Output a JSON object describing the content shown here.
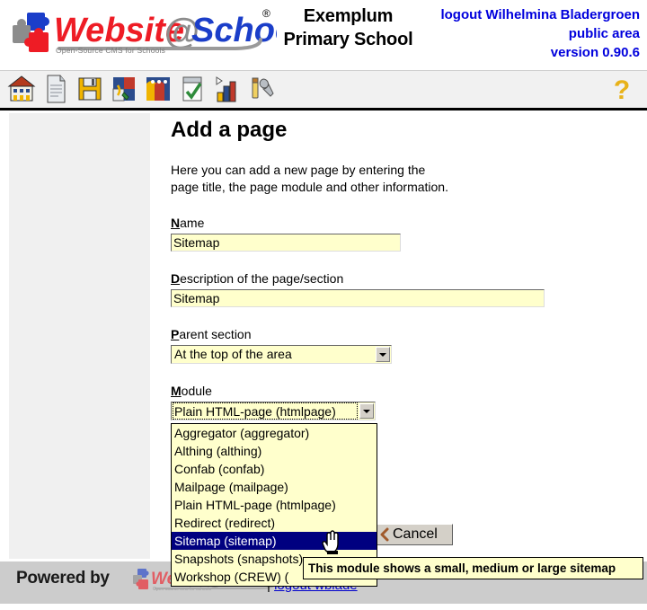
{
  "header": {
    "logo_alt": "Website@School",
    "logo_tagline": "Open-Source CMS for Schools",
    "logo_registered": "®",
    "school_name_line1": "Exemplum",
    "school_name_line2": "Primary School",
    "logout_label": "logout Wilhelmina Bladergroen",
    "area_label": "public area",
    "version_label": "version 0.90.6"
  },
  "toolbar": {
    "icons": [
      {
        "name": "home-icon",
        "title": "Home"
      },
      {
        "name": "page-icon",
        "title": "Page"
      },
      {
        "name": "save-icon",
        "title": "Save"
      },
      {
        "name": "pagemanager-icon",
        "title": "Page manager"
      },
      {
        "name": "users-icon",
        "title": "Users"
      },
      {
        "name": "tasks-icon",
        "title": "Tasks"
      },
      {
        "name": "statistics-icon",
        "title": "Statistics"
      },
      {
        "name": "tools-icon",
        "title": "Tools"
      }
    ],
    "help_icon": "help-question-icon",
    "help_label": "?"
  },
  "content": {
    "title": "Add a page",
    "intro": "Here you can add a new page by entering the page title, the page module and other information.",
    "fields": {
      "name": {
        "accesskey": "N",
        "label_rest": "ame",
        "value": "Sitemap"
      },
      "description": {
        "accesskey": "D",
        "label_rest": "escription of the page/section",
        "value": "Sitemap"
      },
      "parent_section": {
        "accesskey": "P",
        "label_rest": "arent section",
        "value": "At the top of the area",
        "options": [
          "At the top of the area"
        ]
      },
      "module": {
        "accesskey": "M",
        "label_rest": "odule",
        "value": "Plain HTML-page (htmlpage)",
        "options": [
          "Aggregator (aggregator)",
          "Althing (althing)",
          "Confab (confab)",
          "Mailpage (mailpage)",
          "Plain HTML-page (htmlpage)",
          "Redirect (redirect)",
          "Sitemap (sitemap)",
          "Snapshots (snapshots)",
          "Workshop (CREW) ("
        ],
        "highlighted_option": "Sitemap (sitemap)",
        "dropdown_open": true
      }
    },
    "cancel_button": {
      "label": "Cancel",
      "icon": "cancel-arrow-icon"
    },
    "tooltip": "This module shows a small, medium or large sitemap"
  },
  "footer": {
    "powered_by": "Powered by",
    "logo_alt": "Website@School",
    "separator": "|",
    "logout_link": "logout wblade"
  },
  "colors": {
    "link_blue": "#0000dd",
    "field_yellow": "#ffffcc",
    "highlight_navy": "#000080",
    "footer_gray": "#cccccc",
    "sidebar_gray": "#f0f0f0",
    "toolbar_gray": "#f1f1f1",
    "logo_red": "#ee1c25",
    "logo_blue": "#1b3ec9",
    "help_yellow": "#e8b219"
  }
}
